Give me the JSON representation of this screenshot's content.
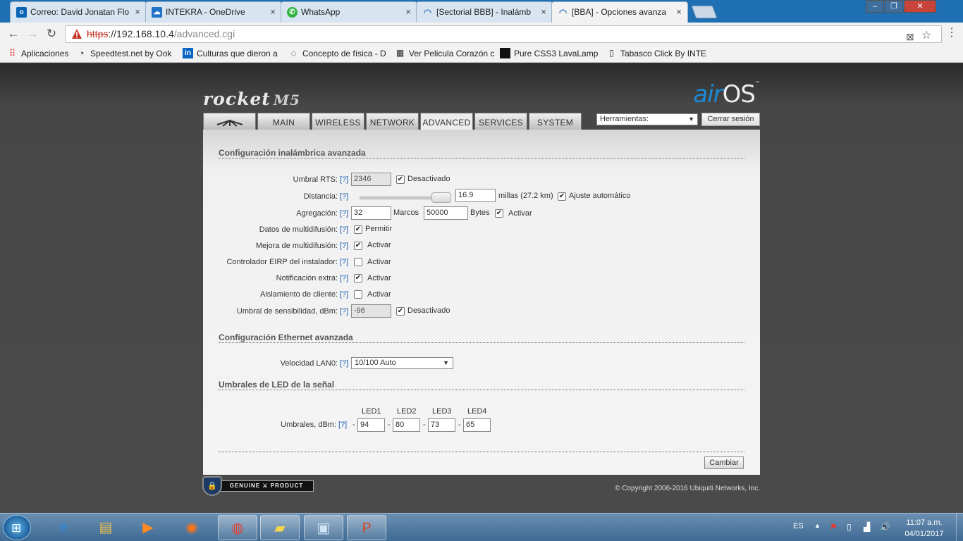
{
  "browser": {
    "tabs": [
      {
        "label": "Correo: David Jonatan Flo",
        "icon": "outlook-icon",
        "active": false
      },
      {
        "label": "INTEKRA - OneDrive",
        "icon": "onedrive-icon",
        "active": false
      },
      {
        "label": "WhatsApp",
        "icon": "whatsapp-icon",
        "active": false
      },
      {
        "label": "[Sectorial BBB] - Inalámb",
        "icon": "wifi-icon",
        "active": false
      },
      {
        "label": "[BBA] - Opciones avanza",
        "icon": "wifi-icon",
        "active": true
      }
    ],
    "url_scheme": "https",
    "url_host": "://192.168.10.4",
    "url_path": "/advanced.cgi",
    "bookmarks": [
      "Aplicaciones",
      "Speedtest.net by Ook",
      "Culturas que dieron a",
      "Concepto de física - D",
      "Ver Pelicula Corazón c",
      "Pure CSS3 LavaLamp",
      "Tabasco Click By INTE"
    ]
  },
  "app": {
    "brand": "rocket",
    "model": "M5",
    "os_brand_air": "air",
    "os_brand_os": "OS",
    "os_tm": "™",
    "nav_tabs": [
      "MAIN",
      "WIRELESS",
      "NETWORK",
      "ADVANCED",
      "SERVICES",
      "SYSTEM"
    ],
    "active_tab": "ADVANCED",
    "tools_select": "Herramientas:",
    "logout": "Cerrar sesión"
  },
  "wireless": {
    "title": "Configuración inalámbrica avanzada",
    "help": "[?]",
    "rts_label": "Umbral RTS:",
    "rts_value": "2346",
    "rts_disabled_label": "Desactivado",
    "distance_label": "Distancia:",
    "distance_value": "16.9",
    "distance_unit": "millas (27.2 km)",
    "auto_adjust_label": "Ajuste automático",
    "aggregation_label": "Agregación:",
    "aggregation_frames": "32",
    "frames_label": "Marcos",
    "aggregation_bytes": "50000",
    "bytes_label": "Bytes",
    "aggregation_enable": "Activar",
    "multicast_data_label": "Datos de multidifusión:",
    "multicast_data_value": "Permitir",
    "multicast_enh_label": "Mejora de multidifusión:",
    "multicast_enh_value": "Activar",
    "eirp_label": "Controlador EIRP del instalador:",
    "eirp_value": "Activar",
    "extra_notif_label": "Notificación extra:",
    "extra_notif_value": "Activar",
    "client_iso_label": "Aislamiento de cliente:",
    "client_iso_value": "Activar",
    "sens_label": "Umbral de sensibilidad, dBm:",
    "sens_value": "-96",
    "sens_disabled_label": "Desactivado"
  },
  "ethernet": {
    "title": "Configuración Ethernet avanzada",
    "lan_speed_label": "Velocidad LAN0:",
    "lan_speed_value": "10/100 Auto"
  },
  "led": {
    "title": "Umbrales de LED de la señal",
    "headers": [
      "LED1",
      "LED2",
      "LED3",
      "LED4"
    ],
    "label": "Umbrales, dBm:",
    "values": [
      "94",
      "80",
      "73",
      "65"
    ],
    "dash": "-"
  },
  "apply_label": "Cambiar",
  "footer": {
    "genuine": "GENUINE ⚔ PRODUCT",
    "copyright": "© Copyright 2006-2016 Ubiquiti Networks, Inc."
  },
  "taskbar": {
    "lang": "ES",
    "time": "11:07 a.m.",
    "date": "04/01/2017"
  }
}
